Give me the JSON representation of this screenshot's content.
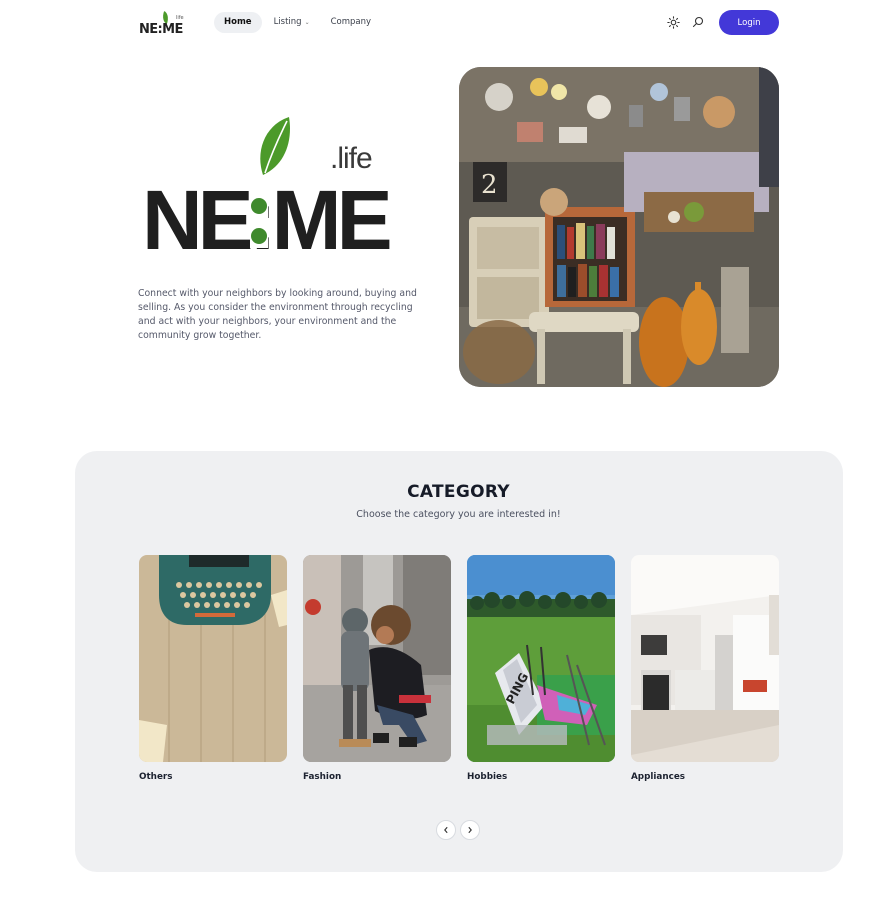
{
  "brand": {
    "word": "NE:ME",
    "suffix": ".life",
    "small_suffix": "life"
  },
  "nav": {
    "items": [
      {
        "label": "Home",
        "active": true
      },
      {
        "label": "Listing",
        "has_dropdown": true
      },
      {
        "label": "Company"
      }
    ]
  },
  "header": {
    "theme_icon": "sun-icon",
    "search_icon": "search-icon",
    "login_label": "Login"
  },
  "hero": {
    "logo_word": "NE:ME",
    "logo_suffix": ".life",
    "description": "Connect with your neighbors by looking around, buying and selling. As you consider the environment through recycling and act with your neighbors, your environment and the community grow together."
  },
  "category": {
    "title": "CATEGORY",
    "subtitle": "Choose the category you are interested in!",
    "cards": [
      {
        "label": "Others"
      },
      {
        "label": "Fashion"
      },
      {
        "label": "Hobbies"
      },
      {
        "label": "Appliances"
      }
    ],
    "prev_icon": "chevron-left-icon",
    "next_icon": "chevron-right-icon"
  },
  "colors": {
    "accent": "#4338d8",
    "leaf_green": "#4c9a2a",
    "panel_bg": "#eff0f2",
    "text_dark": "#161b28"
  }
}
